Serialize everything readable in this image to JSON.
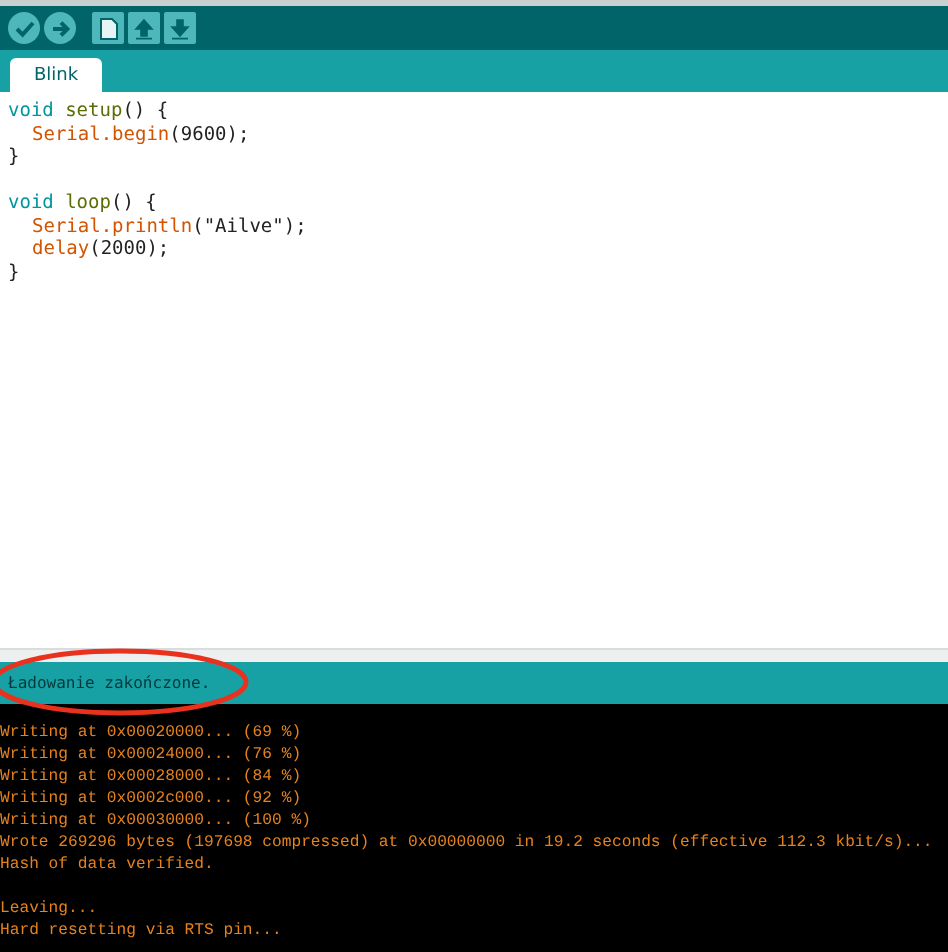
{
  "toolbar": {
    "buttons": [
      {
        "kind": "verify"
      },
      {
        "kind": "upload"
      },
      {
        "kind": "new"
      },
      {
        "kind": "open"
      },
      {
        "kind": "save"
      }
    ]
  },
  "tabs": [
    {
      "label": "Blink",
      "selected": true
    }
  ],
  "editor": {
    "lines": [
      {
        "tokens": [
          {
            "text": "void",
            "kind": "type"
          },
          {
            "text": "setup",
            "kind": "func"
          },
          {
            "text": "() {",
            "kind": "plain"
          }
        ]
      },
      {
        "indent": true,
        "tokens": [
          {
            "text": "Serial.",
            "kind": "class"
          },
          {
            "text": "begin",
            "kind": "method"
          },
          {
            "text": "(9600);",
            "kind": "plain"
          }
        ]
      },
      {
        "tokens": [
          {
            "text": "}",
            "kind": "plain"
          }
        ]
      },
      {
        "gap_before": true,
        "tokens": [
          {
            "text": "void",
            "kind": "type"
          },
          {
            "text": "loop",
            "kind": "func"
          },
          {
            "text": "() {",
            "kind": "plain"
          }
        ]
      },
      {
        "indent": true,
        "tokens": [
          {
            "text": "Serial.",
            "kind": "class"
          },
          {
            "text": "println",
            "kind": "method"
          },
          {
            "text": "(\"Ailve\");",
            "kind": "plain"
          }
        ]
      },
      {
        "indent": true,
        "tokens": [
          {
            "text": "delay",
            "kind": "method"
          },
          {
            "text": "(2000);",
            "kind": "plain"
          }
        ]
      },
      {
        "tokens": [
          {
            "text": "}",
            "kind": "plain"
          }
        ]
      }
    ]
  },
  "status_bar": {
    "message": "Ładowanie zakończone.",
    "highlighted": true
  },
  "console": {
    "lines": [
      {
        "text": "Writing at 0x00020000... (69 %)"
      },
      {
        "text": "Writing at 0x00024000... (76 %)"
      },
      {
        "text": "Writing at 0x00028000... (84 %)"
      },
      {
        "text": "Writing at 0x0002c000... (92 %)"
      },
      {
        "text": "Writing at 0x00030000... (100 %)"
      },
      {
        "text": "Wrote 269296 bytes (197698 compressed) at 0x00000000 in 19.2 seconds (effective 112.3 kbit/s)..."
      },
      {
        "text": "Hash of data verified."
      },
      {
        "text": "Leaving...",
        "gap_before": true
      },
      {
        "text": "Hard resetting via RTS pin..."
      }
    ]
  }
}
